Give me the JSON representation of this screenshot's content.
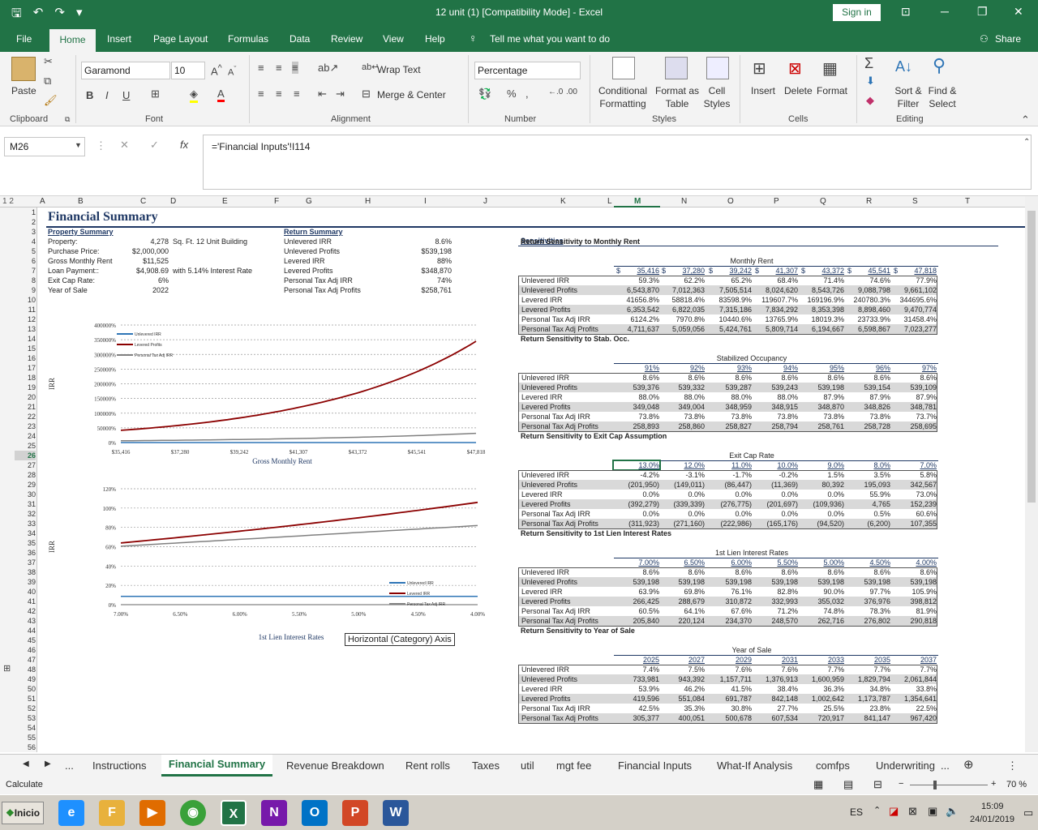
{
  "window": {
    "title": "12 unit (1)  [Compatibility Mode]  -  Excel",
    "sign_in": "Sign in"
  },
  "menu": {
    "tabs": [
      "File",
      "Home",
      "Insert",
      "Page Layout",
      "Formulas",
      "Data",
      "Review",
      "View",
      "Help"
    ],
    "tell_me": "Tell me what you want to do",
    "share": "Share"
  },
  "ribbon": {
    "clipboard": {
      "paste": "Paste",
      "label": "Clipboard"
    },
    "font": {
      "name": "Garamond",
      "size": "10",
      "label": "Font",
      "bold": "B",
      "italic": "I",
      "underline": "U"
    },
    "alignment": {
      "wrap": "Wrap Text",
      "merge": "Merge & Center",
      "label": "Alignment"
    },
    "number": {
      "format": "Percentage",
      "percent": "%",
      "comma": ",",
      "label": "Number"
    },
    "styles": {
      "conditional": "Conditional Formatting",
      "format_table": "Format as Table",
      "cell_styles": "Cell Styles",
      "label": "Styles"
    },
    "cells": {
      "insert": "Insert",
      "delete": "Delete",
      "format": "Format",
      "label": "Cells"
    },
    "editing": {
      "sort": "Sort & Filter",
      "find": "Find & Select",
      "label": "Editing"
    }
  },
  "formula_bar": {
    "name_box": "M26",
    "fx": "fx",
    "formula": "='Financial Inputs'!I114"
  },
  "columns": [
    "A",
    "B",
    "C",
    "D",
    "E",
    "F",
    "G",
    "H",
    "I",
    "J",
    "K",
    "L",
    "M",
    "N",
    "O",
    "P",
    "Q",
    "R",
    "S",
    "T"
  ],
  "rows": [
    "1",
    "2",
    "3",
    "4",
    "5",
    "6",
    "7",
    "8",
    "9",
    "10",
    "11",
    "12",
    "13",
    "14",
    "15",
    "16",
    "17",
    "18",
    "19",
    "20",
    "21",
    "22",
    "23",
    "24",
    "25",
    "26",
    "27",
    "28",
    "29",
    "30",
    "31",
    "32",
    "33",
    "34",
    "35",
    "36",
    "37",
    "38",
    "39",
    "40",
    "41",
    "42",
    "43",
    "44",
    "45",
    "46",
    "47",
    "48",
    "49",
    "50",
    "51",
    "52",
    "53",
    "54",
    "55",
    "56"
  ],
  "outline_levels": "1 2",
  "sheet": {
    "title": "Financial Summary",
    "property": {
      "header": "Property Summary",
      "rows": [
        {
          "label": "Property:",
          "value": "4,278",
          "extra": "Sq. Ft. 12 Unit Building"
        },
        {
          "label": "Purchase Price:",
          "value": "$2,000,000",
          "extra": ""
        },
        {
          "label": "Gross Monthly Rent",
          "value": "$11,525",
          "extra": ""
        },
        {
          "label": "Loan Payment::",
          "value": "$4,908.69",
          "extra": "with 5.14% Interest Rate"
        },
        {
          "label": "Exit Cap Rate:",
          "value": "6%",
          "extra": ""
        },
        {
          "label": "Year of Sale",
          "value": "2022",
          "extra": ""
        }
      ]
    },
    "returns": {
      "header": "Return Summary",
      "rows": [
        {
          "label": "Unlevered IRR",
          "value": "8.6%"
        },
        {
          "label": "Unlevered Profits",
          "value": "$539,198"
        },
        {
          "label": "Levered IRR",
          "value": "88%"
        },
        {
          "label": "Levered Profits",
          "value": "$348,870"
        },
        {
          "label": "Personal Tax Adj IRR",
          "value": "74%"
        },
        {
          "label": "Personal Tax Adj Profits",
          "value": "$258,761"
        }
      ]
    },
    "sensitivities_header": "Sensitivities",
    "tables": [
      {
        "title": "Return Sensitivity to Monthly Rent",
        "subheader": "Monthly Rent",
        "dollar": true,
        "cols": [
          "35,416",
          "37,280",
          "39,242",
          "41,307",
          "43,372",
          "45,541",
          "47,818"
        ],
        "rows": [
          {
            "label": "Unlevered IRR",
            "values": [
              "59.3%",
              "62.2%",
              "65.2%",
              "68.4%",
              "71.4%",
              "74.6%",
              "77.9%"
            ]
          },
          {
            "label": "Unlevered Profits",
            "values": [
              "6,543,870",
              "7,012,363",
              "7,505,514",
              "8,024,620",
              "8,543,726",
              "9,088,798",
              "9,661,102"
            ]
          },
          {
            "label": "Levered IRR",
            "values": [
              "41656.8%",
              "58818.4%",
              "83598.9%",
              "119607.7%",
              "169196.9%",
              "240780.3%",
              "344695.6%"
            ]
          },
          {
            "label": "Levered Profits",
            "values": [
              "6,353,542",
              "6,822,035",
              "7,315,186",
              "7,834,292",
              "8,353,398",
              "8,898,460",
              "9,470,774"
            ]
          },
          {
            "label": "Personal Tax Adj IRR",
            "values": [
              "6124.2%",
              "7970.8%",
              "10440.6%",
              "13765.9%",
              "18019.3%",
              "23733.9%",
              "31458.4%"
            ]
          },
          {
            "label": "Personal Tax Adj Profits",
            "values": [
              "4,711,637",
              "5,059,056",
              "5,424,761",
              "5,809,714",
              "6,194,667",
              "6,598,867",
              "7,023,277"
            ]
          }
        ]
      },
      {
        "title": "Return Sensitivity to Stab. Occ.",
        "subheader": "Stabilized Occupancy",
        "dollar": false,
        "cols": [
          "91%",
          "92%",
          "93%",
          "94%",
          "95%",
          "96%",
          "97%"
        ],
        "rows": [
          {
            "label": "Unlevered IRR",
            "values": [
              "8.6%",
              "8.6%",
              "8.6%",
              "8.6%",
              "8.6%",
              "8.6%",
              "8.6%"
            ]
          },
          {
            "label": "Unlevered Profits",
            "values": [
              "539,376",
              "539,332",
              "539,287",
              "539,243",
              "539,198",
              "539,154",
              "539,109"
            ]
          },
          {
            "label": "Levered IRR",
            "values": [
              "88.0%",
              "88.0%",
              "88.0%",
              "88.0%",
              "87.9%",
              "87.9%",
              "87.9%"
            ]
          },
          {
            "label": "Levered Profits",
            "values": [
              "349,048",
              "349,004",
              "348,959",
              "348,915",
              "348,870",
              "348,826",
              "348,781"
            ]
          },
          {
            "label": "Personal Tax Adj IRR",
            "values": [
              "73.8%",
              "73.8%",
              "73.8%",
              "73.8%",
              "73.8%",
              "73.8%",
              "73.7%"
            ]
          },
          {
            "label": "Personal Tax Adj Profits",
            "values": [
              "258,893",
              "258,860",
              "258,827",
              "258,794",
              "258,761",
              "258,728",
              "258,695"
            ]
          }
        ]
      },
      {
        "title": "Return Sensitivity to Exit Cap Assumption",
        "subheader": "Exit Cap Rate",
        "dollar": false,
        "cols": [
          "13.0%",
          "12.0%",
          "11.0%",
          "10.0%",
          "9.0%",
          "8.0%",
          "7.0%"
        ],
        "rows": [
          {
            "label": "Unlevered IRR",
            "values": [
              "-4.2%",
              "-3.1%",
              "-1.7%",
              "-0.2%",
              "1.5%",
              "3.5%",
              "5.8%"
            ]
          },
          {
            "label": "Unlevered Profits",
            "values": [
              "(201,950)",
              "(149,011)",
              "(86,447)",
              "(11,369)",
              "80,392",
              "195,093",
              "342,567"
            ]
          },
          {
            "label": "Levered IRR",
            "values": [
              "0.0%",
              "0.0%",
              "0.0%",
              "0.0%",
              "0.0%",
              "55.9%",
              "73.0%"
            ]
          },
          {
            "label": "Levered Profits",
            "values": [
              "(392,279)",
              "(339,339)",
              "(276,775)",
              "(201,697)",
              "(109,936)",
              "4,765",
              "152,239"
            ]
          },
          {
            "label": "Personal Tax Adj IRR",
            "values": [
              "0.0%",
              "0.0%",
              "0.0%",
              "0.0%",
              "0.0%",
              "0.5%",
              "60.6%"
            ]
          },
          {
            "label": "Personal Tax Adj Profits",
            "values": [
              "(311,923)",
              "(271,160)",
              "(222,986)",
              "(165,176)",
              "(94,520)",
              "(6,200)",
              "107,355"
            ]
          }
        ]
      },
      {
        "title": "Return Sensitivity to 1st Lien Interest Rates",
        "subheader": "1st Lien Interest Rates",
        "dollar": false,
        "cols": [
          "7.00%",
          "6.50%",
          "6.00%",
          "5.50%",
          "5.00%",
          "4.50%",
          "4.00%"
        ],
        "rows": [
          {
            "label": "Unlevered IRR",
            "values": [
              "8.6%",
              "8.6%",
              "8.6%",
              "8.6%",
              "8.6%",
              "8.6%",
              "8.6%"
            ]
          },
          {
            "label": "Unlevered Profits",
            "values": [
              "539,198",
              "539,198",
              "539,198",
              "539,198",
              "539,198",
              "539,198",
              "539,198"
            ]
          },
          {
            "label": "Levered IRR",
            "values": [
              "63.9%",
              "69.8%",
              "76.1%",
              "82.8%",
              "90.0%",
              "97.7%",
              "105.9%"
            ]
          },
          {
            "label": "Levered Profits",
            "values": [
              "266,425",
              "288,679",
              "310,872",
              "332,993",
              "355,032",
              "376,976",
              "398,812"
            ]
          },
          {
            "label": "Personal Tax Adj IRR",
            "values": [
              "60.5%",
              "64.1%",
              "67.6%",
              "71.2%",
              "74.8%",
              "78.3%",
              "81.9%"
            ]
          },
          {
            "label": "Personal Tax Adj Profits",
            "values": [
              "205,840",
              "220,124",
              "234,370",
              "248,570",
              "262,716",
              "276,802",
              "290,818"
            ]
          }
        ]
      },
      {
        "title": "Return Sensitivity to Year of Sale",
        "subheader": "Year of Sale",
        "dollar": false,
        "cols": [
          "2025",
          "2027",
          "2029",
          "2031",
          "2033",
          "2035",
          "2037"
        ],
        "rows": [
          {
            "label": "Unlevered IRR",
            "values": [
              "7.4%",
              "7.5%",
              "7.6%",
              "7.6%",
              "7.7%",
              "7.7%",
              "7.7%"
            ]
          },
          {
            "label": "Unlevered Profits",
            "values": [
              "733,981",
              "943,392",
              "1,157,711",
              "1,376,913",
              "1,600,959",
              "1,829,794",
              "2,061,844"
            ]
          },
          {
            "label": "Levered IRR",
            "values": [
              "53.9%",
              "46.2%",
              "41.5%",
              "38.4%",
              "36.3%",
              "34.8%",
              "33.8%"
            ]
          },
          {
            "label": "Levered Profits",
            "values": [
              "419,596",
              "551,084",
              "691,787",
              "842,148",
              "1,002,642",
              "1,173,787",
              "1,354,641"
            ]
          },
          {
            "label": "Personal Tax Adj IRR",
            "values": [
              "42.5%",
              "35.3%",
              "30.8%",
              "27.7%",
              "25.5%",
              "23.8%",
              "22.5%"
            ]
          },
          {
            "label": "Personal Tax Adj Profits",
            "values": [
              "305,377",
              "400,051",
              "500,678",
              "607,534",
              "720,917",
              "841,147",
              "967,420"
            ]
          }
        ]
      }
    ],
    "tooltip": "Horizontal (Category) Axis"
  },
  "chart_data": [
    {
      "type": "line",
      "ylabel": "IRR",
      "xlabel": "Gross Monthly Rent",
      "categories": [
        "$35,416",
        "$37,280",
        "$39,242",
        "$41,307",
        "$43,372",
        "$45,541",
        "$47,818"
      ],
      "yticks": [
        "0%",
        "50000%",
        "100000%",
        "150000%",
        "200000%",
        "250000%",
        "300000%",
        "350000%",
        "400000%"
      ],
      "ylim": [
        0,
        400000
      ],
      "legend": "top-left",
      "grid": true,
      "series": [
        {
          "name": "Unlevered IRR",
          "color": "#2e75b6",
          "values": [
            59.3,
            62.2,
            65.2,
            68.4,
            71.4,
            74.6,
            77.9
          ]
        },
        {
          "name": "Levered Profits",
          "color": "#8b0000",
          "values": [
            41656.8,
            58818.4,
            83598.9,
            119607.7,
            169196.9,
            240780.3,
            344695.6
          ]
        },
        {
          "name": "Personal Tax Adj IRR",
          "color": "#808080",
          "values": [
            6124.2,
            7970.8,
            10440.6,
            13765.9,
            18019.3,
            23733.9,
            31458.4
          ]
        }
      ]
    },
    {
      "type": "line",
      "ylabel": "IRR",
      "xlabel": "1st Lien Interest Rates",
      "categories": [
        "7.00%",
        "6.50%",
        "6.00%",
        "5.50%",
        "5.00%",
        "4.50%",
        "4.00%"
      ],
      "yticks": [
        "0%",
        "20%",
        "40%",
        "60%",
        "80%",
        "100%",
        "120%"
      ],
      "ylim": [
        0,
        120
      ],
      "legend": "bottom-right",
      "grid": true,
      "series": [
        {
          "name": "Unlevered IRR",
          "color": "#2e75b6",
          "values": [
            8.6,
            8.6,
            8.6,
            8.6,
            8.6,
            8.6,
            8.6
          ]
        },
        {
          "name": "Levered IRR",
          "color": "#8b0000",
          "values": [
            63.9,
            69.8,
            76.1,
            82.8,
            90.0,
            97.7,
            105.9
          ]
        },
        {
          "name": "Personal Tax Adj IRR",
          "color": "#808080",
          "values": [
            60.5,
            64.1,
            67.6,
            71.2,
            74.8,
            78.3,
            81.9
          ]
        }
      ]
    }
  ],
  "sheet_tabs": [
    "...",
    "Instructions",
    "Financial Summary",
    "Revenue Breakdown",
    "Rent rolls",
    "Taxes",
    "util",
    "mgt fee",
    "Financial Inputs",
    "What-If Analysis",
    "comfps",
    "Underwriting",
    "..."
  ],
  "status": {
    "mode": "Calculate",
    "zoom": "70 %"
  },
  "taskbar": {
    "start": "Inicio",
    "lang": "ES",
    "time": "15:09",
    "date": "24/01/2019",
    "apps": [
      "e",
      "F",
      "▶",
      "◉",
      "X",
      "N",
      "O",
      "P",
      "W"
    ]
  }
}
